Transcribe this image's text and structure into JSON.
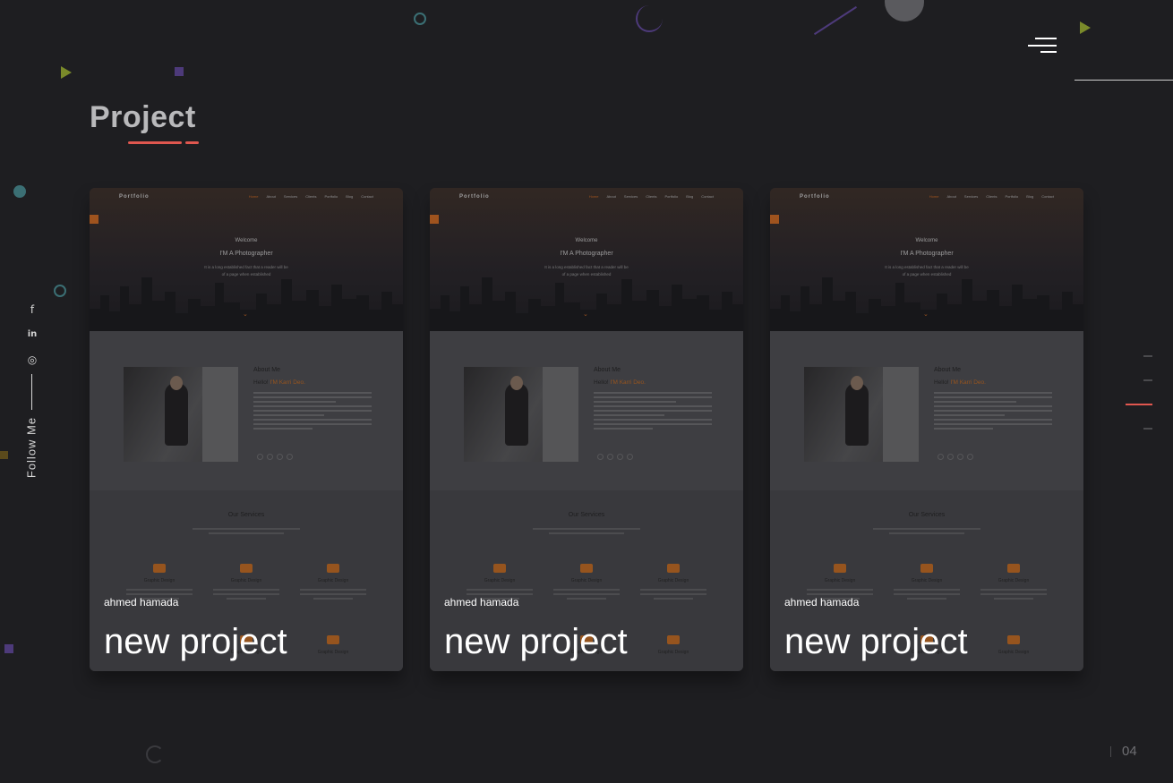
{
  "page": {
    "title": "Project"
  },
  "menu": {
    "icon": "hamburger-menu-icon"
  },
  "follow": {
    "label": "Follow Me",
    "icons": [
      {
        "name": "facebook-icon",
        "glyph": "f"
      },
      {
        "name": "linkedin-icon",
        "glyph": "in"
      },
      {
        "name": "instagram-icon",
        "glyph": "◎"
      }
    ]
  },
  "pager": {
    "current": "04"
  },
  "preview": {
    "brand": "Portfolio",
    "nav": [
      "Home",
      "About",
      "Services",
      "Clients",
      "Portfolio",
      "Blog",
      "Contact"
    ],
    "welcome": "Welcome",
    "tagline": "I'M A Photographer",
    "intro_line1": "It is a long established fact that a reader will be",
    "intro_line2": "of a page when established",
    "about_title": "About Me",
    "hello": "Hello!",
    "hello_name": "I'M Karri Deo.",
    "services_title": "Our Services",
    "service_name": "Graphic Design"
  },
  "cards": [
    {
      "author": "ahmed hamada",
      "title": "new project"
    },
    {
      "author": "ahmed hamada",
      "title": "new project"
    },
    {
      "author": "ahmed hamada",
      "title": "new project"
    }
  ],
  "colors": {
    "accent": "#e0574f",
    "preview_accent": "#d2691e",
    "background": "#1e1e21"
  }
}
